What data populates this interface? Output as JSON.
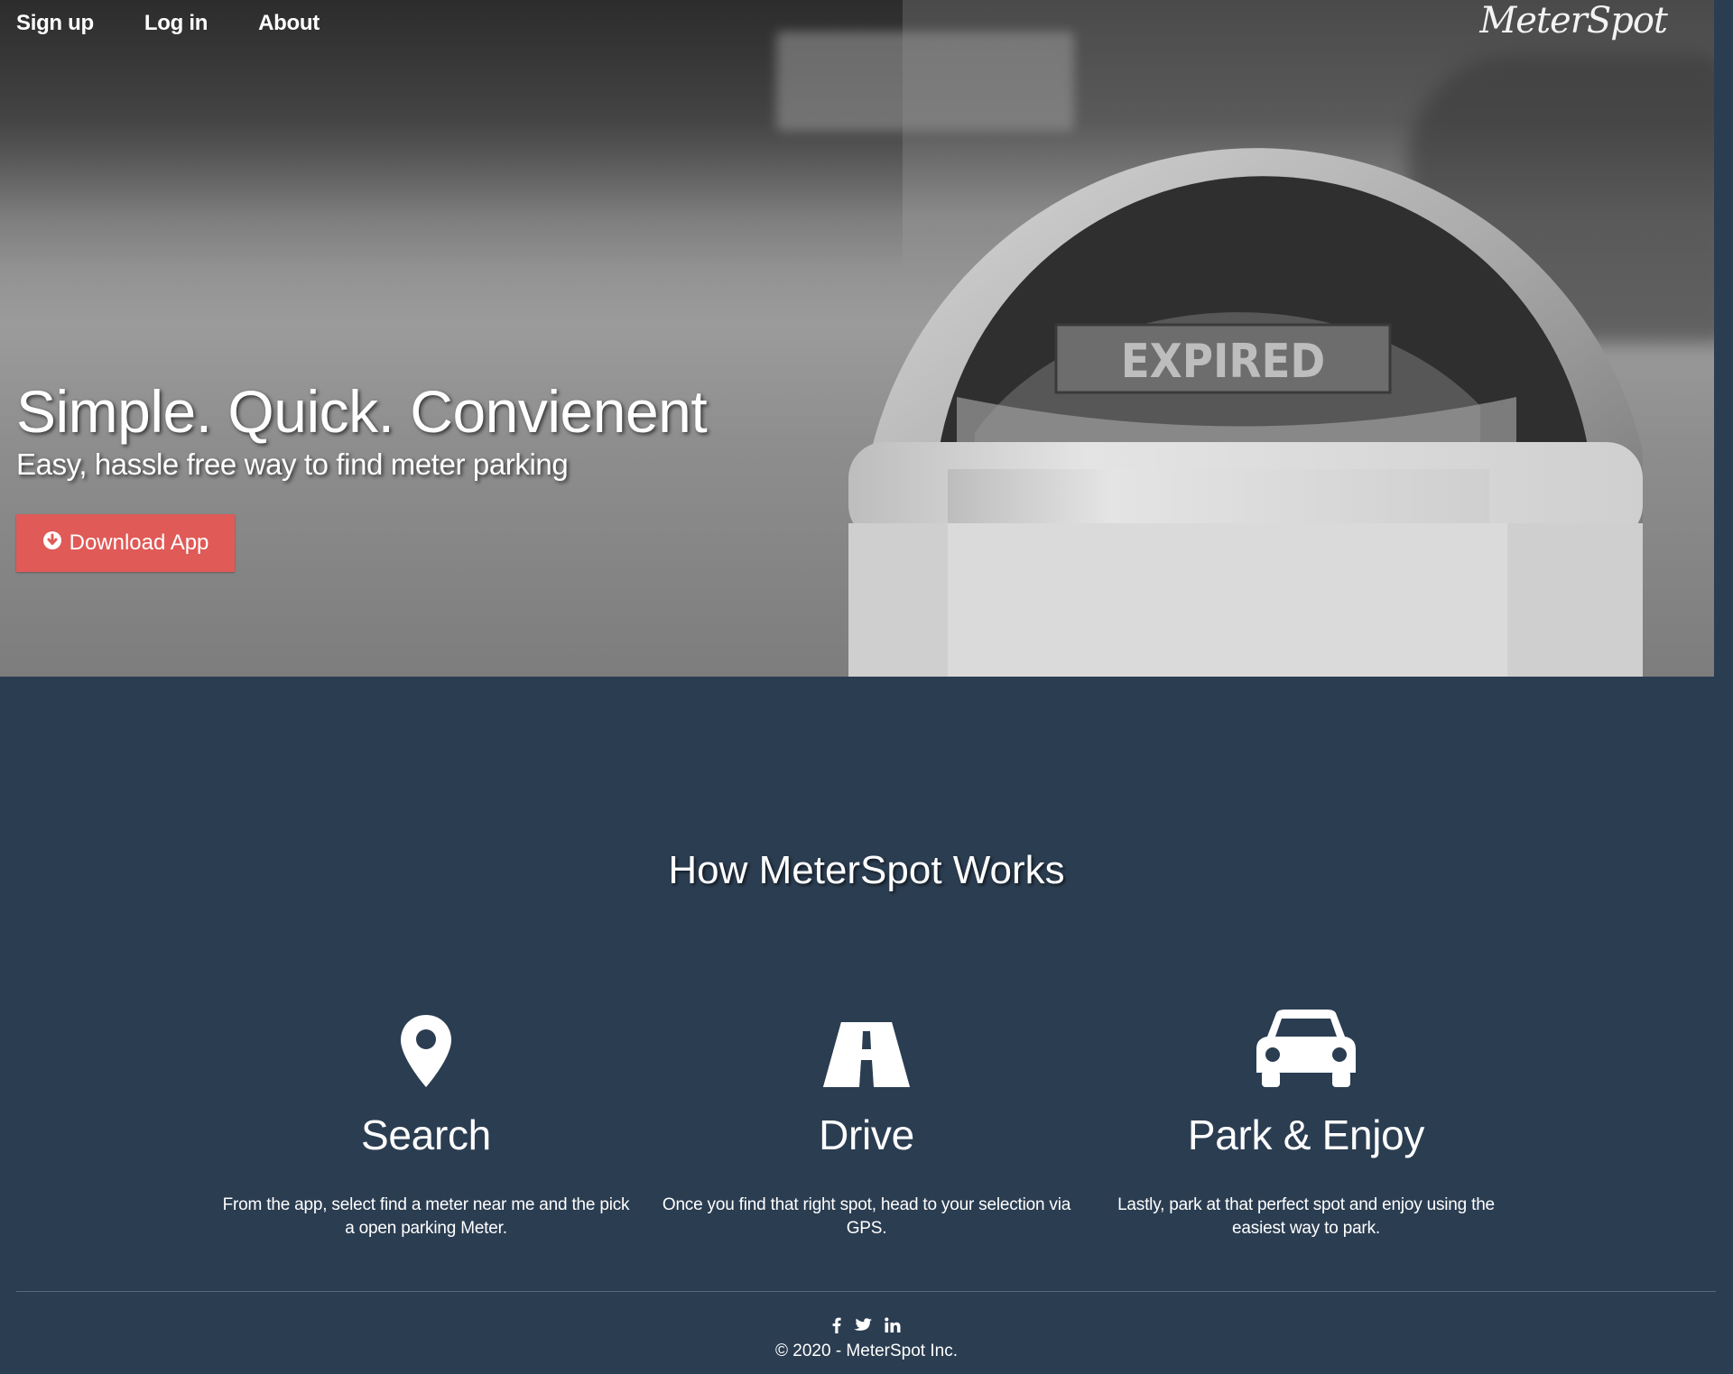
{
  "nav": {
    "items": [
      {
        "label": "Sign up"
      },
      {
        "label": "Log in"
      },
      {
        "label": "About"
      }
    ],
    "brand": "MeterSpot"
  },
  "hero": {
    "title": "Simple. Quick. Convienent",
    "subtitle": "Easy, hassle free way to find meter parking",
    "download_button": {
      "label": "Download App",
      "icon": "arrow-circle-down-icon"
    },
    "image_text": "EXPIRED"
  },
  "how_it_works": {
    "title": "How MeterSpot Works",
    "features": [
      {
        "icon": "map-marker-icon",
        "title": "Search",
        "text": "From the app, select find a meter near me and the pick a open parking Meter."
      },
      {
        "icon": "road-icon",
        "title": "Drive",
        "text": "Once you find that right spot, head to your selection via GPS."
      },
      {
        "icon": "car-icon",
        "title": "Park & Enjoy",
        "text": "Lastly, park at that perfect spot and enjoy using the easiest way to park."
      }
    ]
  },
  "footer": {
    "social": [
      "facebook-icon",
      "twitter-icon",
      "linkedin-icon"
    ],
    "copyright": "© 2020 - MeterSpot Inc."
  },
  "colors": {
    "background": "#2b3d51",
    "accent": "#e05a57",
    "text": "#ffffff"
  }
}
